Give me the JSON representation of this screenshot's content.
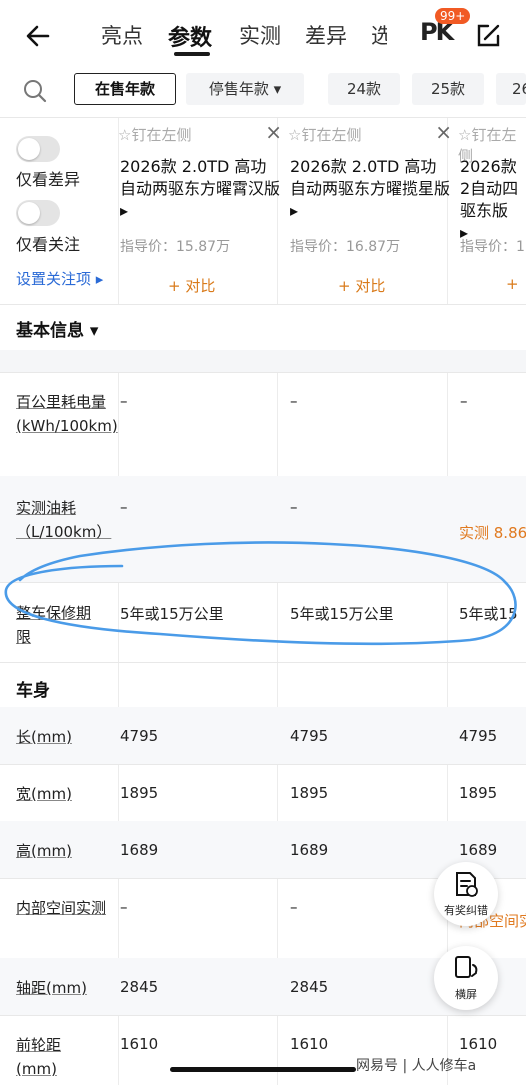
{
  "topbar": {
    "tabs": [
      "亮点",
      "参数",
      "实测",
      "差异",
      "选"
    ],
    "active_tab": "参数",
    "pk_label": "PK",
    "pk_badge": "99+"
  },
  "filters": {
    "chips": [
      "在售年款",
      "停售年款 ▾",
      "24款",
      "25款",
      "26"
    ],
    "selected": "在售年款"
  },
  "left_panel": {
    "diff_label": "仅看差异",
    "follow_label": "仅看关注",
    "settings_link": "设置关注项 ▸"
  },
  "cars": [
    {
      "pin": "钉在左侧",
      "name": "2026款 2.0TD 高功自动两驱东方曜霄汉版 ▸",
      "price": "指导价：15.87万",
      "compare": "+ 对比"
    },
    {
      "pin": "钉在左侧",
      "name": "2026款 2.0TD 高功自动两驱东方曜揽星版 ▸",
      "price": "指导价：16.87万",
      "compare": "+ 对比"
    },
    {
      "pin": "钉在左侧",
      "name": "2026款 2自动四驱东版 ▸",
      "price": "指导价：1",
      "compare": "+"
    }
  ],
  "sections": {
    "basic_info": "基本信息 ▾",
    "body": "车身"
  },
  "rows": [
    {
      "label": "百公里耗电量(kWh/100km)",
      "values": [
        "–",
        "–",
        "–"
      ]
    },
    {
      "label": "实测油耗（L/100km）",
      "values": [
        "–",
        "–",
        "实测 8.86"
      ]
    },
    {
      "label": "整车保修期限",
      "values": [
        "5年或15万公里",
        "5年或15万公里",
        "5年或15"
      ]
    },
    {
      "label": "长(mm)",
      "values": [
        "4795",
        "4795",
        "4795"
      ]
    },
    {
      "label": "宽(mm)",
      "values": [
        "1895",
        "1895",
        "1895"
      ]
    },
    {
      "label": "高(mm)",
      "values": [
        "1689",
        "1689",
        "1689"
      ]
    },
    {
      "label": "内部空间实测",
      "values": [
        "–",
        "–",
        "内部空间实"
      ]
    },
    {
      "label": "轴距(mm)",
      "values": [
        "2845",
        "2845",
        "2845"
      ]
    },
    {
      "label": "前轮距(mm)",
      "values": [
        "1610",
        "1610",
        "1610"
      ]
    }
  ],
  "fabs": {
    "report_label": "有奖纠错",
    "landscape_label": "横屏"
  },
  "watermark": "网易号 | 人人修车a",
  "colors": {
    "accent_orange": "#e07a20",
    "link_blue": "#2a6ad6",
    "annotation_blue": "#4a9be8"
  }
}
